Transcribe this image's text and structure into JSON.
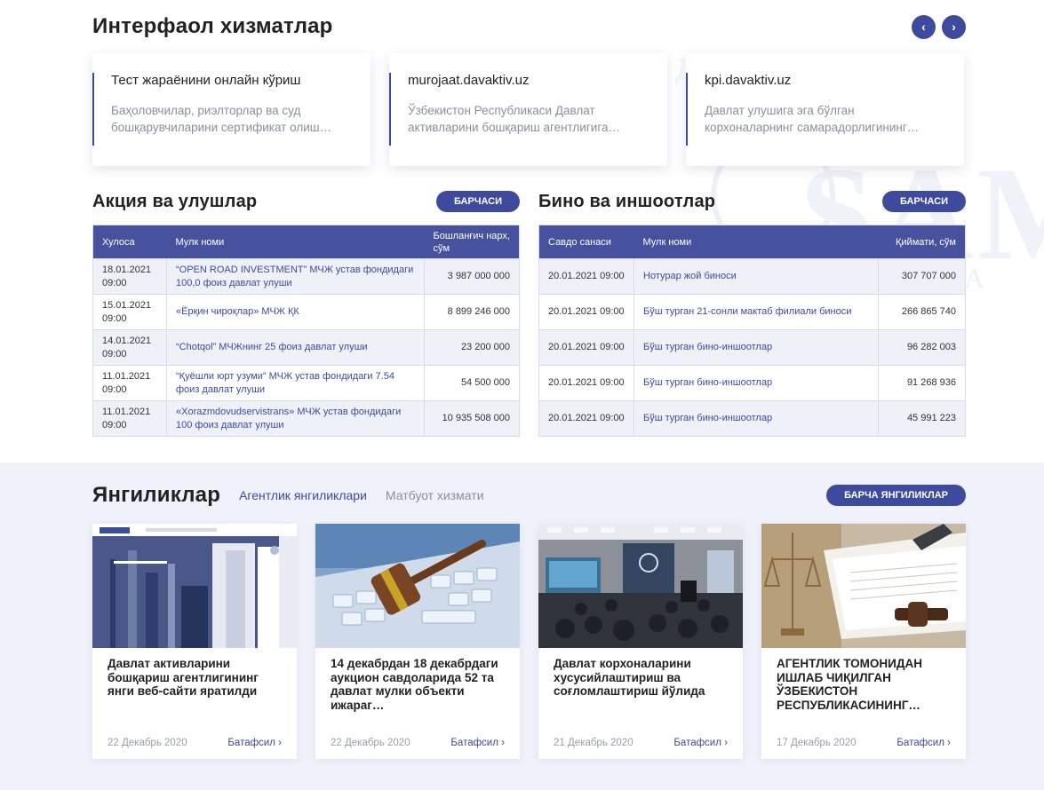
{
  "services": {
    "title": "Интерфаол хизматлар",
    "prev_icon": "‹",
    "next_icon": "›",
    "cards": [
      {
        "title": "Тест жараёнини онлайн кўриш",
        "description": "Баҳоловчилар, риэлторлар ва суд бошқарувчиларини сертификат олиш…"
      },
      {
        "title": "murojaat.davaktiv.uz",
        "description": "Ўзбекистон Республикаси Давлат активларини бошқариш агентлигига…"
      },
      {
        "title": "kpi.davaktiv.uz",
        "description": "Давлат улушига эга бўлган корхоналарнинг самарадорлигининг…"
      }
    ]
  },
  "shares": {
    "title": "Акция ва улушлар",
    "all_label": "Барчаси",
    "columns": [
      "Хулоса",
      "Мулк номи",
      "Бошланғич нарх, сўм"
    ],
    "rows": [
      {
        "date": "18.01.2021 09:00",
        "name": "“OPEN ROAD INVESTMENT” МЧЖ устав фондидаги 100,0 фоиз давлат улуши",
        "price": "3 987 000 000"
      },
      {
        "date": "15.01.2021 09:00",
        "name": "«Ёрқин чироқлар» МЧЖ ҚК",
        "price": "8 899 246 000"
      },
      {
        "date": "14.01.2021 09:00",
        "name": "“Chotqol” МЧЖнинг 25 фоиз давлат улуши",
        "price": "23 200 000"
      },
      {
        "date": "11.01.2021 09:00",
        "name": "“Қуёшли юрт узуми” МЧЖ устав фондидаги 7.54 фоиз давлат улуши",
        "price": "54 500 000"
      },
      {
        "date": "11.01.2021 09:00",
        "name": "«Xorazmdovudservistrans» МЧЖ устав фондидаги 100 фоиз давлат улуши",
        "price": "10 935 508 000"
      }
    ]
  },
  "buildings": {
    "title": "Бино ва иншоотлар",
    "all_label": "Барчаси",
    "columns": [
      "Савдо санаси",
      "Мулк номи",
      "Қиймати, сўм"
    ],
    "rows": [
      {
        "date": "20.01.2021 09:00",
        "name": "Нотурар жой биноси",
        "price": "307 707 000"
      },
      {
        "date": "20.01.2021 09:00",
        "name": "Бўш турган 21-сонли мактаб филиали биноси",
        "price": "266 865 740"
      },
      {
        "date": "20.01.2021 09:00",
        "name": "Бўш турган бино-иншоотлар",
        "price": "96 282 003"
      },
      {
        "date": "20.01.2021 09:00",
        "name": "Бўш турган бино-иншоотлар",
        "price": "91 268 936"
      },
      {
        "date": "20.01.2021 09:00",
        "name": "Бўш турган бино-иншоотлар",
        "price": "45 991 223"
      }
    ]
  },
  "news": {
    "title": "Янгиликлар",
    "tab_agency": "Агентлик янгиликлари",
    "tab_press": "Матбуот хизмати",
    "all_label": "Барча янгиликлар",
    "more_label": "Батафсил",
    "more_icon": "›",
    "cards": [
      {
        "title": "Давлат активларини бошқариш агентлигининг янги веб-сайти яратилди",
        "date": "22 Декабрь 2020",
        "image": "website-screenshot"
      },
      {
        "title": "14 декабрдан 18 декабрдаги аукцион савдоларида 52 та давлат мулки объекти ижараг…",
        "date": "22 Декабрь 2020",
        "image": "gavel-keyboard"
      },
      {
        "title": "Давлат корхоналарини хусусийлаштириш ва соғломлаштириш йўлида",
        "date": "21 Декабрь 2020",
        "image": "conference-hall"
      },
      {
        "title": "АГЕНТЛИК ТОМОНИДАН ИШЛАБ ЧИҚИЛГАН ЎЗБЕКИСТОН РЕСПУБЛИКАСИНИНГ…",
        "date": "17 Декабрь 2020",
        "image": "documents-gavel"
      }
    ]
  },
  "colors": {
    "accent": "#3e4a9c",
    "table_header": "#46529d",
    "news_bg": "#eff1fb"
  }
}
